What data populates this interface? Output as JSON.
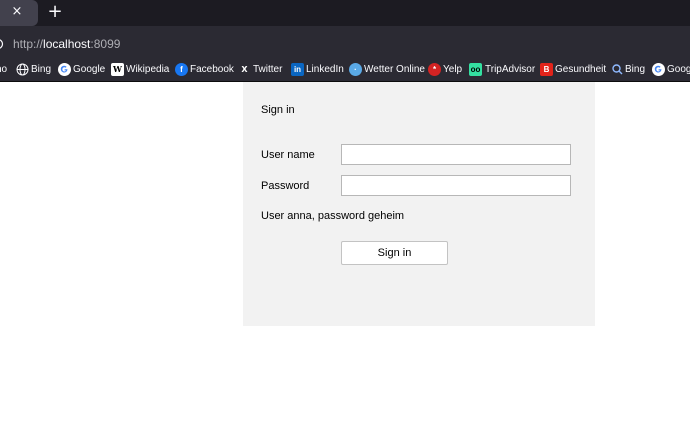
{
  "tabs": {
    "close_glyph": "×",
    "new_tab_glyph": "+"
  },
  "urlbar": {
    "scheme": "http://",
    "host": "localhost",
    "port": ":8099",
    "site_icon": "info-icon"
  },
  "bookmarks": [
    {
      "label": "no",
      "icon": "truncated-icon"
    },
    {
      "label": "Bing",
      "icon": "globe-icon"
    },
    {
      "label": "Google",
      "icon": "google-icon"
    },
    {
      "label": "Wikipedia",
      "icon": "wikipedia-icon"
    },
    {
      "label": "Facebook",
      "icon": "facebook-icon"
    },
    {
      "label": "Twitter",
      "icon": "x-icon"
    },
    {
      "label": "LinkedIn",
      "icon": "linkedin-icon"
    },
    {
      "label": "Wetter Online",
      "icon": "wetter-online-icon"
    },
    {
      "label": "Yelp",
      "icon": "yelp-icon"
    },
    {
      "label": "TripAdvisor",
      "icon": "tripadvisor-icon"
    },
    {
      "label": "Gesundheit",
      "icon": "gesundheit-icon"
    },
    {
      "label": "Bing",
      "icon": "search-icon"
    },
    {
      "label": "Goog",
      "icon": "google-icon"
    }
  ],
  "signin": {
    "title": "Sign in",
    "username_label": "User name",
    "username_value": "",
    "password_label": "Password",
    "password_value": "",
    "hint": "User anna, password geheim",
    "submit_label": "Sign in"
  },
  "colors": {
    "tabstrip_bg": "#1c1b22",
    "toolbar_bg": "#2b2a33",
    "panel_bg": "#f2f2f2"
  }
}
